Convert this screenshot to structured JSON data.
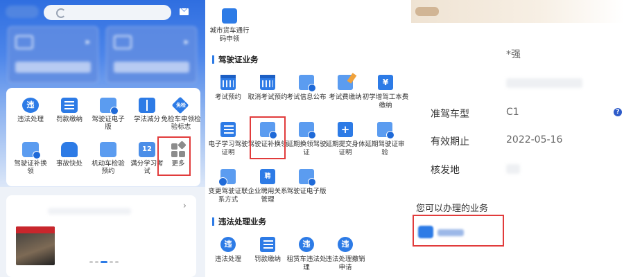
{
  "left_panel": {
    "services": [
      {
        "label": "违法处理",
        "icon": "violation-icon",
        "glyph": "违"
      },
      {
        "label": "罚款缴纳",
        "icon": "fine-icon",
        "glyph": ""
      },
      {
        "label": "驾驶证电子版",
        "icon": "license-card-icon",
        "glyph": ""
      },
      {
        "label": "学法减分",
        "icon": "study-book-icon",
        "glyph": ""
      },
      {
        "label": "免检车申领检验标志",
        "icon": "inspection-free-icon",
        "glyph": "免检"
      },
      {
        "label": "驾驶证补换领",
        "icon": "license-reissue-icon",
        "glyph": ""
      },
      {
        "label": "事故快处",
        "icon": "accident-car-icon",
        "glyph": ""
      },
      {
        "label": "机动车检验预约",
        "icon": "vehicle-check-icon",
        "glyph": ""
      },
      {
        "label": "满分学习考试",
        "icon": "full-score-icon",
        "glyph": "12"
      },
      {
        "label": "更多",
        "icon": "more-grid-icon",
        "glyph": ""
      }
    ]
  },
  "middle_panel": {
    "top_item": {
      "label": "城市货车通行码申领",
      "icon": "truck-pass-icon"
    },
    "sections": [
      {
        "title": "驾驶证业务",
        "items": [
          {
            "label": "考试预约",
            "icon": "exam-booking-icon",
            "glyph": ""
          },
          {
            "label": "取消考试预约",
            "icon": "cancel-booking-icon",
            "glyph": ""
          },
          {
            "label": "考试信息公布",
            "icon": "exam-info-icon",
            "glyph": ""
          },
          {
            "label": "考试费缴纳",
            "icon": "exam-fee-icon",
            "glyph": ""
          },
          {
            "label": "初学增驾工本费缴纳",
            "icon": "cost-fee-icon",
            "glyph": "¥"
          },
          {
            "label": "电子学习驾驶证明",
            "icon": "e-learning-cert-icon",
            "glyph": ""
          },
          {
            "label": "驾驶证补换领",
            "icon": "license-reissue-icon",
            "glyph": ""
          },
          {
            "label": "延期换领驾驶证",
            "icon": "extend-renewal-icon",
            "glyph": ""
          },
          {
            "label": "延期提交身体证明",
            "icon": "health-cert-icon",
            "glyph": "+"
          },
          {
            "label": "延期驾驶证审验",
            "icon": "license-audit-icon",
            "glyph": ""
          },
          {
            "label": "变更驾驶证联系方式",
            "icon": "contact-change-icon",
            "glyph": ""
          },
          {
            "label": "企业聘用关系管理",
            "icon": "employment-icon",
            "glyph": "聘"
          },
          {
            "label": "驾驶证电子版",
            "icon": "license-card-icon",
            "glyph": ""
          }
        ]
      },
      {
        "title": "违法处理业务",
        "items": [
          {
            "label": "违法处理",
            "icon": "violation-icon",
            "glyph": "违"
          },
          {
            "label": "罚款缴纳",
            "icon": "fine-icon",
            "glyph": ""
          },
          {
            "label": "租赁车违法处理",
            "icon": "rental-violation-icon",
            "glyph": "违"
          },
          {
            "label": "违法处理撤销申请",
            "icon": "revoke-icon",
            "glyph": "违"
          }
        ]
      }
    ]
  },
  "right_panel": {
    "name_value": "*强",
    "rows": [
      {
        "key": "准驾车型",
        "value": "C1"
      },
      {
        "key": "有效期止",
        "value": "2022-05-16"
      },
      {
        "key": "核发地",
        "value": ""
      }
    ],
    "help_glyph": "?",
    "services_title": "您可以办理的业务"
  }
}
